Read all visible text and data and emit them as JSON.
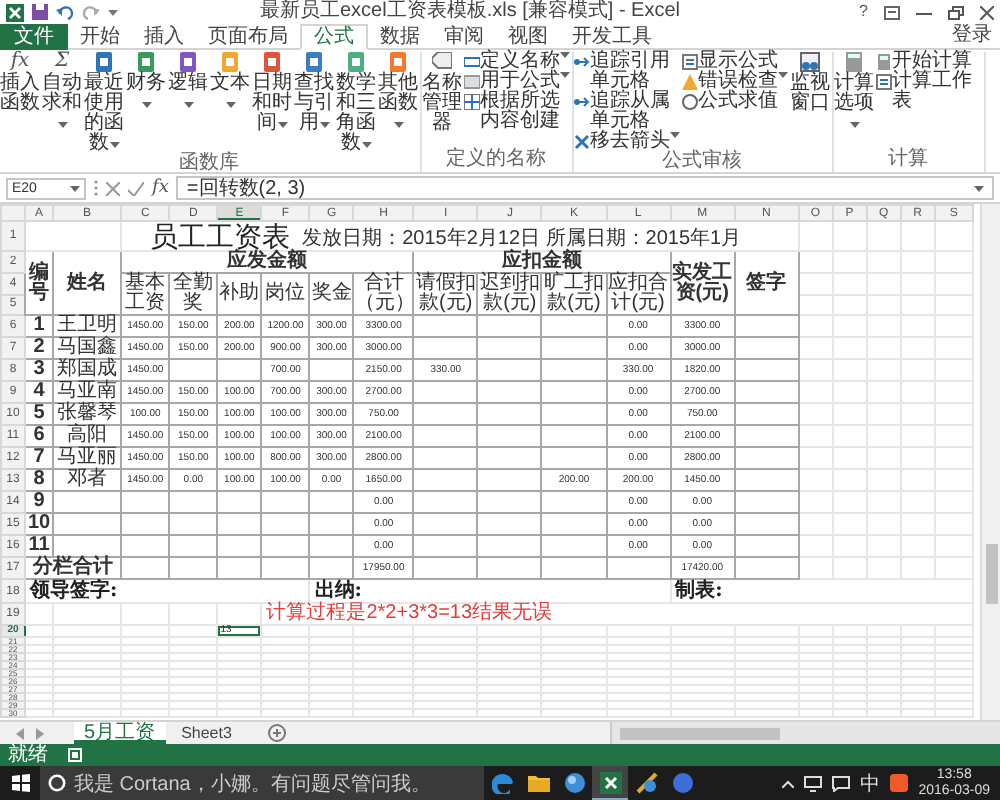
{
  "title_bar": {
    "title": "最新员工excel工资表模板.xls [兼容模式] - Excel",
    "help": "?"
  },
  "ribbon_tabs": [
    {
      "label": "文件",
      "kind": "file",
      "selected": false
    },
    {
      "label": "开始",
      "kind": "tab",
      "selected": false
    },
    {
      "label": "插入",
      "kind": "tab",
      "selected": false
    },
    {
      "label": "页面布局",
      "kind": "tab",
      "selected": false
    },
    {
      "label": "公式",
      "kind": "tab",
      "selected": true
    },
    {
      "label": "数据",
      "kind": "tab",
      "selected": false
    },
    {
      "label": "审阅",
      "kind": "tab",
      "selected": false
    },
    {
      "label": "视图",
      "kind": "tab",
      "selected": false
    },
    {
      "label": "开发工具",
      "kind": "tab",
      "selected": false
    }
  ],
  "sign_in": "登录",
  "ribbon_groups": [
    {
      "label": "函数库",
      "items": [
        {
          "kind": "large",
          "label": "插入函数",
          "glyph": "fx",
          "menu": false
        },
        {
          "kind": "large",
          "label": "自动求和",
          "glyph": "Σ",
          "menu": true
        },
        {
          "kind": "large",
          "label": "最近使用的函数",
          "menu": true
        },
        {
          "kind": "large",
          "label": "财务",
          "menu": true
        },
        {
          "kind": "large",
          "label": "逻辑",
          "menu": true
        },
        {
          "kind": "large",
          "label": "文本",
          "menu": true
        },
        {
          "kind": "large",
          "label": "日期和时间",
          "menu": true
        },
        {
          "kind": "large",
          "label": "查找与引用",
          "menu": true
        },
        {
          "kind": "large",
          "label": "数学和三角函数",
          "menu": true
        },
        {
          "kind": "large",
          "label": "其他函数",
          "menu": true
        }
      ]
    },
    {
      "label": "定义的名称",
      "items": [
        {
          "kind": "large",
          "label": "名称管理器",
          "menu": false
        },
        {
          "kind": "column",
          "items": [
            {
              "label": "定义名称",
              "menu": true
            },
            {
              "label": "用于公式",
              "menu": true
            },
            {
              "label": "根据所选内容创建",
              "menu": false
            }
          ]
        }
      ]
    },
    {
      "label": "公式审核",
      "items": [
        {
          "kind": "column",
          "items": [
            {
              "label": "追踪引用单元格",
              "menu": false
            },
            {
              "label": "追踪从属单元格",
              "menu": false
            },
            {
              "label": "移去箭头",
              "menu": true
            }
          ]
        },
        {
          "kind": "column",
          "items": [
            {
              "label": "显示公式",
              "menu": false
            },
            {
              "label": "错误检查",
              "menu": true
            },
            {
              "label": "公式求值",
              "menu": false
            }
          ]
        },
        {
          "kind": "large",
          "label": "监视窗口",
          "menu": false
        }
      ]
    },
    {
      "label": "计算",
      "items": [
        {
          "kind": "large",
          "label": "计算选项",
          "menu": true
        },
        {
          "kind": "column",
          "items": [
            {
              "label": "开始计算",
              "menu": false
            },
            {
              "label": "计算工作表",
              "menu": false
            }
          ]
        }
      ]
    }
  ],
  "formula_bar": {
    "name_box": "E20",
    "function_label": "fx",
    "formula": "=回转数(2, 3)"
  },
  "sheet": {
    "columns": [
      {
        "label": "A",
        "selected": false
      },
      {
        "label": "B",
        "selected": false
      },
      {
        "label": "C",
        "selected": false
      },
      {
        "label": "D",
        "selected": false
      },
      {
        "label": "E",
        "selected": true
      },
      {
        "label": "F",
        "selected": false
      },
      {
        "label": "G",
        "selected": false
      },
      {
        "label": "H",
        "selected": false
      },
      {
        "label": "I",
        "selected": false
      },
      {
        "label": "J",
        "selected": false
      },
      {
        "label": "K",
        "selected": false
      },
      {
        "label": "L",
        "selected": false
      },
      {
        "label": "M",
        "selected": false
      },
      {
        "label": "N",
        "selected": false
      },
      {
        "label": "O",
        "selected": false
      },
      {
        "label": "P",
        "selected": false
      },
      {
        "label": "Q",
        "selected": false
      },
      {
        "label": "R",
        "selected": false
      },
      {
        "label": "S",
        "selected": false
      }
    ],
    "row_headers": [
      {
        "label": "1",
        "selected": false
      },
      {
        "label": "2",
        "selected": false
      },
      {
        "label": "4",
        "selected": false
      },
      {
        "label": "5",
        "selected": false
      },
      {
        "label": "6",
        "selected": false
      },
      {
        "label": "7",
        "selected": false
      },
      {
        "label": "8",
        "selected": false
      },
      {
        "label": "9",
        "selected": false
      },
      {
        "label": "10",
        "selected": false
      },
      {
        "label": "11",
        "selected": false
      },
      {
        "label": "12",
        "selected": false
      },
      {
        "label": "13",
        "selected": false
      },
      {
        "label": "14",
        "selected": false
      },
      {
        "label": "15",
        "selected": false
      },
      {
        "label": "16",
        "selected": false
      },
      {
        "label": "17",
        "selected": false
      },
      {
        "label": "18",
        "selected": false
      },
      {
        "label": "19",
        "selected": false
      },
      {
        "label": "20",
        "selected": true
      },
      {
        "label": "21",
        "selected": false
      },
      {
        "label": "22",
        "selected": false
      },
      {
        "label": "23",
        "selected": false
      },
      {
        "label": "24",
        "selected": false
      },
      {
        "label": "25",
        "selected": false
      },
      {
        "label": "26",
        "selected": false
      },
      {
        "label": "27",
        "selected": false
      },
      {
        "label": "28",
        "selected": false
      },
      {
        "label": "29",
        "selected": false
      },
      {
        "label": "30",
        "selected": false
      }
    ],
    "title": "员工工资表",
    "date_info": "发放日期：2015年2月12日 所属日期：2015年1月",
    "head": {
      "number": "编号",
      "name": "姓名",
      "pay_group": "应发金额",
      "deduct_group": "应扣金额",
      "pay_items": [
        "基本工资",
        "全勤奖",
        "补助",
        "岗位",
        "奖金",
        "合计（元）"
      ],
      "deduct_items": [
        "请假扣款(元)",
        "迟到扣款(元)",
        "旷工扣款(元)",
        "应扣合计(元)"
      ],
      "net": "实发工资(元)",
      "sign": "签字"
    },
    "rows": [
      {
        "number": "1",
        "name": "王卫明",
        "basic_pay": "1450.00",
        "attendance_bonus": "150.00",
        "allowance": "200.00",
        "post": "1200.00",
        "bonus": "300.00",
        "pay_total": "3300.00",
        "deduction_total": "0.00",
        "net_pay": "3300.00"
      },
      {
        "number": "2",
        "name": "马国鑫",
        "basic_pay": "1450.00",
        "attendance_bonus": "150.00",
        "allowance": "200.00",
        "post": "900.00",
        "bonus": "300.00",
        "pay_total": "3000.00",
        "deduction_total": "0.00",
        "net_pay": "3000.00"
      },
      {
        "number": "3",
        "name": "郑国成",
        "basic_pay": "1450.00",
        "post": "700.00",
        "pay_total": "2150.00",
        "leave_deduction": "330.00",
        "deduction_total": "330.00",
        "net_pay": "1820.00"
      },
      {
        "number": "4",
        "name": "马亚南",
        "basic_pay": "1450.00",
        "attendance_bonus": "150.00",
        "allowance": "100.00",
        "post": "700.00",
        "bonus": "300.00",
        "pay_total": "2700.00",
        "deduction_total": "0.00",
        "net_pay": "2700.00"
      },
      {
        "number": "5",
        "name": "张馨琴",
        "basic_pay": "100.00",
        "attendance_bonus": "150.00",
        "allowance": "100.00",
        "post": "100.00",
        "bonus": "300.00",
        "pay_total": "750.00",
        "deduction_total": "0.00",
        "net_pay": "750.00"
      },
      {
        "number": "6",
        "name": "高阳",
        "basic_pay": "1450.00",
        "attendance_bonus": "150.00",
        "allowance": "100.00",
        "post": "100.00",
        "bonus": "300.00",
        "pay_total": "2100.00",
        "deduction_total": "0.00",
        "net_pay": "2100.00"
      },
      {
        "number": "7",
        "name": "马亚丽",
        "basic_pay": "1450.00",
        "attendance_bonus": "150.00",
        "allowance": "100.00",
        "post": "800.00",
        "bonus": "300.00",
        "pay_total": "2800.00",
        "deduction_total": "0.00",
        "net_pay": "2800.00"
      },
      {
        "number": "8",
        "name": "邓者",
        "basic_pay": "1450.00",
        "attendance_bonus": "0.00",
        "allowance": "100.00",
        "post": "100.00",
        "bonus": "0.00",
        "pay_total": "1650.00",
        "absence_deduction": "200.00",
        "deduction_total": "200.00",
        "net_pay": "1450.00"
      },
      {
        "number": "9",
        "pay_total": "0.00",
        "deduction_total": "0.00",
        "net_pay": "0.00"
      },
      {
        "number": "10",
        "pay_total": "0.00",
        "deduction_total": "0.00",
        "net_pay": "0.00"
      },
      {
        "number": "11",
        "pay_total": "0.00",
        "deduction_total": "0.00",
        "net_pay": "0.00"
      }
    ],
    "total": {
      "label": "分栏合计",
      "pay_total": "17950.00",
      "net_pay": "17420.00"
    },
    "footer": {
      "leader": "领导签字:",
      "cashier": "出纳:",
      "maker": "制表:",
      "note": "计算过程是2*2+3*3=13结果无误"
    },
    "active_cell": {
      "value": "13"
    }
  },
  "sheet_tabs": [
    {
      "label": "5月工资",
      "selected": true
    },
    {
      "label": "Sheet3",
      "selected": false
    }
  ],
  "status": "就绪",
  "taskbar": {
    "search": "我是 Cortana，小娜。有问题尽管问我。",
    "ime": "中",
    "time": "13:58",
    "date": "2016-03-09"
  }
}
